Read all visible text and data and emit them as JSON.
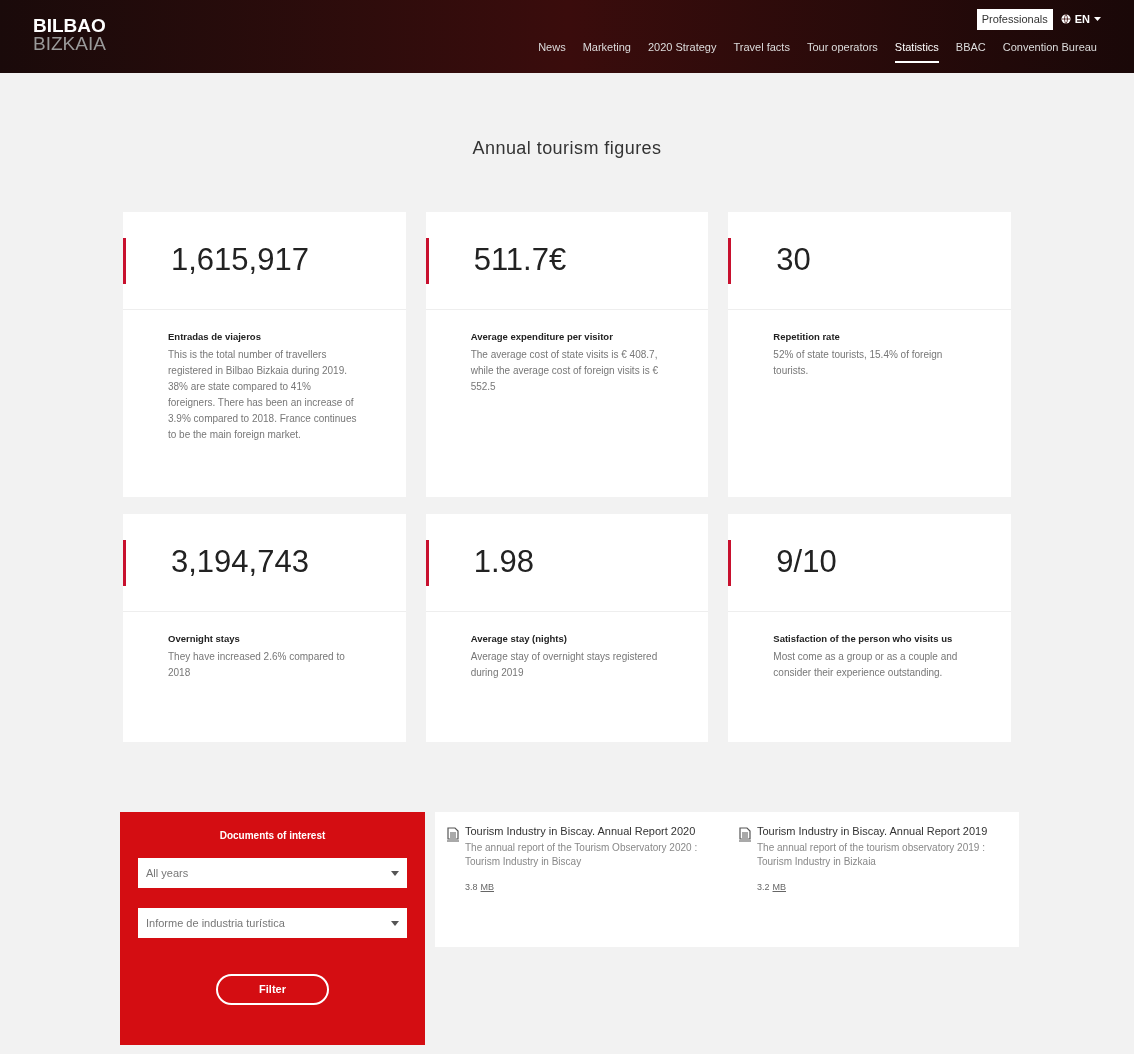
{
  "header": {
    "logo_top": "BILBAO",
    "logo_bottom": "BIZKAIA",
    "professionals": "Professionals",
    "language": "EN",
    "nav": [
      {
        "label": "News",
        "selected": false
      },
      {
        "label": "Marketing",
        "selected": false
      },
      {
        "label": "2020 Strategy",
        "selected": false
      },
      {
        "label": "Travel facts",
        "selected": false
      },
      {
        "label": "Tour operators",
        "selected": false
      },
      {
        "label": "Statistics",
        "selected": true
      },
      {
        "label": "BBAC",
        "selected": false
      },
      {
        "label": "Convention Bureau",
        "selected": false
      }
    ]
  },
  "title": "Annual tourism figures",
  "figures": [
    {
      "value": "1,615,917",
      "label": "Entradas de viajeros",
      "text": "This is the total number of travellers registered in Bilbao Bizkaia during 2019. 38% are state compared to 41% foreigners. There has been an increase of 3.9% compared to 2018. France continues to be the main foreign market."
    },
    {
      "value": "511.7€",
      "label": "Average expenditure per visitor",
      "text": "The average cost of state visits is € 408.7, while the average cost of foreign visits is € 552.5"
    },
    {
      "value": "30",
      "label": "Repetition rate",
      "text": "52% of state tourists, 15.4% of foreign tourists."
    },
    {
      "value": "3,194,743",
      "label": "Overnight stays",
      "text": "They have increased 2.6% compared to 2018"
    },
    {
      "value": "1.98",
      "label": "Average stay (nights)",
      "text": "Average stay of overnight stays registered during 2019"
    },
    {
      "value": "9/10",
      "label": "Satisfaction of the person who visits us",
      "text": "Most come as a group or as a couple and consider their experience outstanding."
    }
  ],
  "documents": {
    "title": "Documents of interest",
    "year_select": "All years",
    "type_select": "Informe de industria turística",
    "filter_button": "Filter",
    "items": [
      {
        "title": "Tourism Industry in Biscay. Annual Report 2020",
        "text": "The annual report of the Tourism Observatory 2020 : Tourism Industry in Biscay",
        "size": "3.8",
        "unit": "MB"
      },
      {
        "title": "Tourism Industry in Biscay. Annual Report 2019",
        "text": "The annual report of the tourism observatory 2019 : Tourism Industry in Bizkaia",
        "size": "3.2",
        "unit": "MB"
      }
    ]
  }
}
